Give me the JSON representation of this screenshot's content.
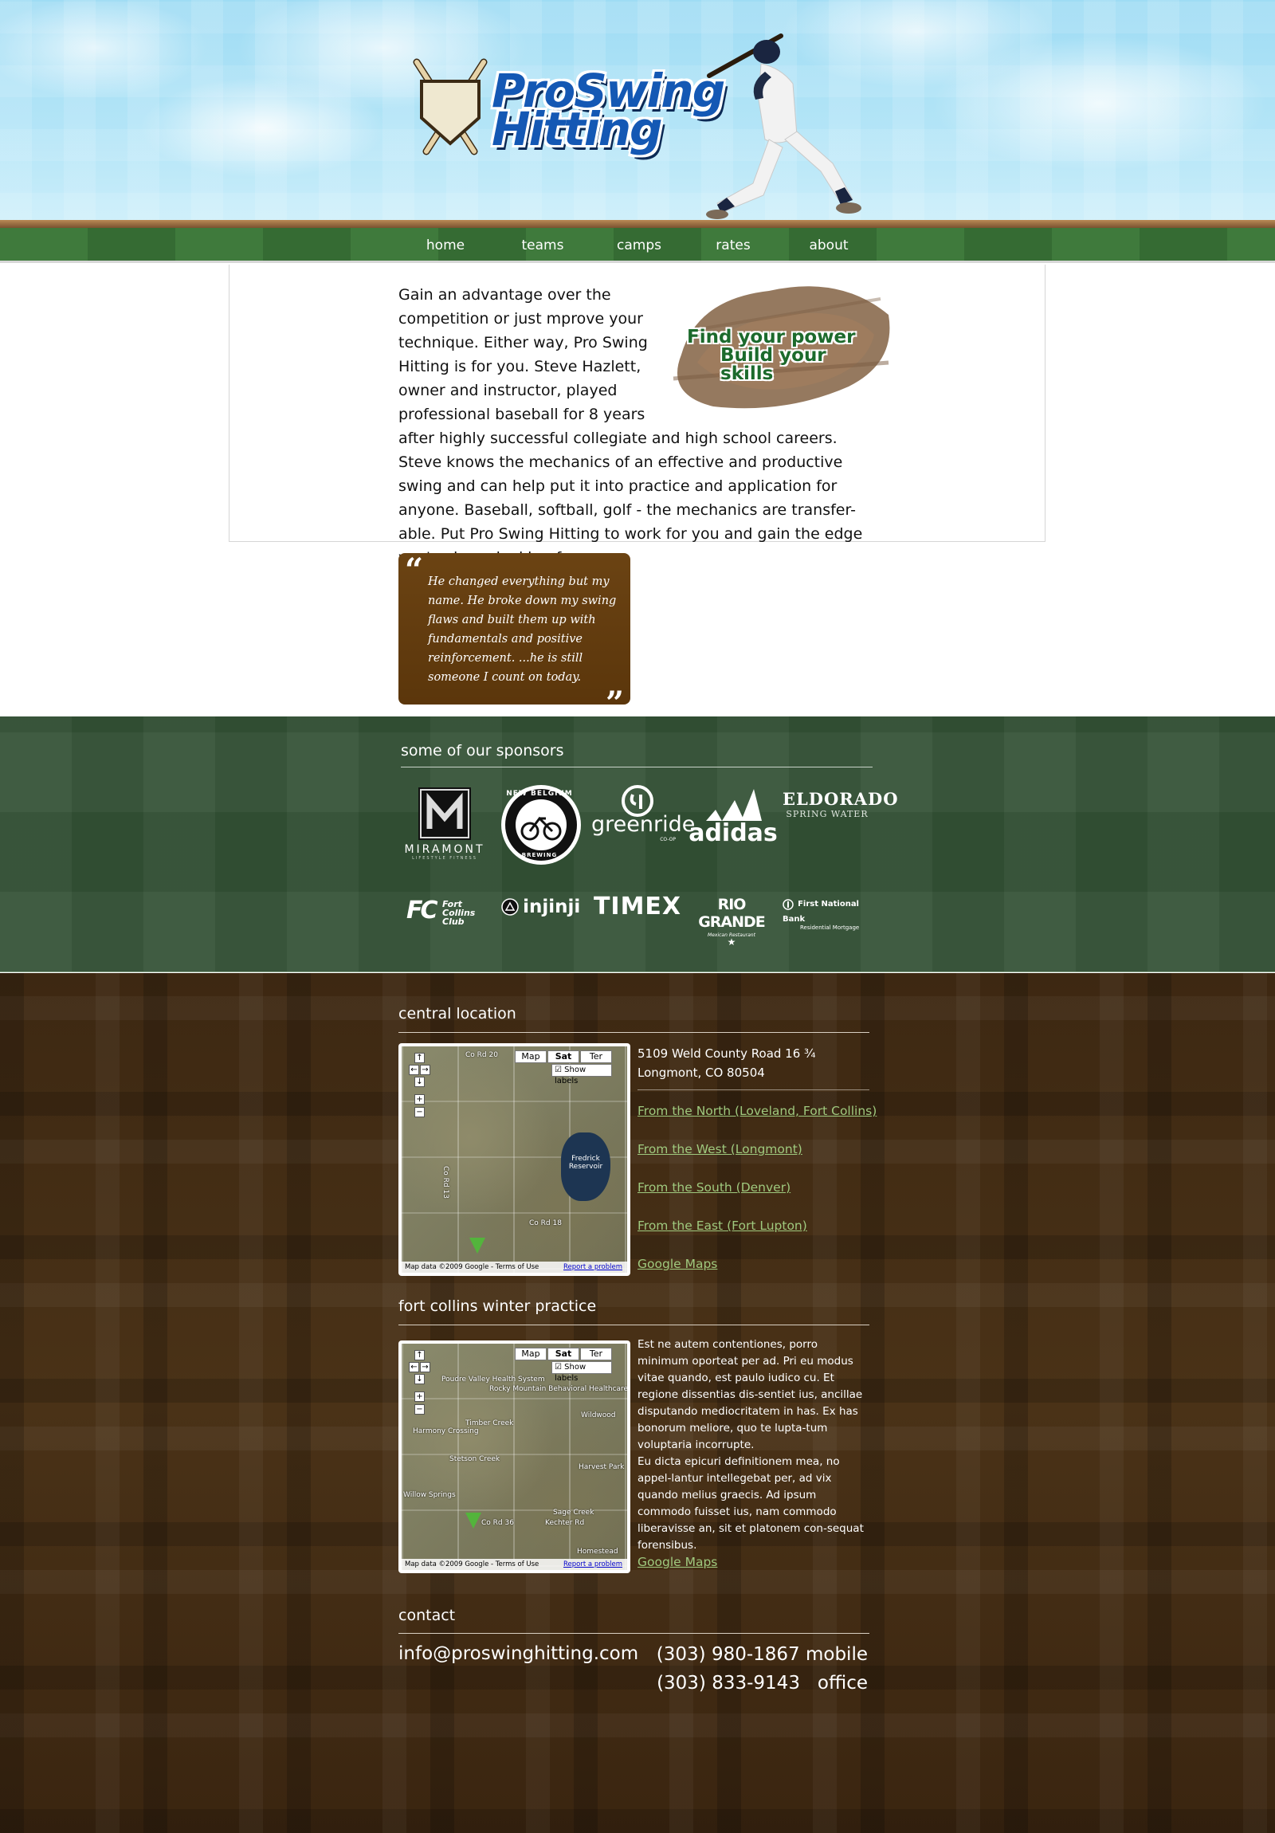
{
  "header": {
    "logo_line1": "ProSwing",
    "logo_line2": "Hitting"
  },
  "nav": {
    "items": [
      "home",
      "teams",
      "camps",
      "rates",
      "about"
    ]
  },
  "intro": {
    "paragraph": "Gain an advantage over the competition or just mprove your technique. Either way, Pro Swing Hitting is for you. Steve Hazlett, owner and instructor, played professional baseball for 8 years after highly successful collegiate and high school careers. Steve knows the mechanics of an effective and productive swing and can help put it into practice and application for anyone. Baseball, softball, golf - the mechanics are transfer-able. Put Pro Swing Hitting to work for you and gain the edge you've been looking for.",
    "tagline_1": "Find your power",
    "tagline_2": "Build your skills"
  },
  "testimonial": {
    "open_mark": "“",
    "text": "He changed everything but my name.  He broke down my swing flaws and built them up with fundamentals and positive reinforcement.  ...he is still someone I count on today.",
    "close_mark": "”"
  },
  "sponsors": {
    "title": "some of our sponsors",
    "logos": [
      {
        "name": "MIRAMONT",
        "sub": "LIFESTYLE FITNESS"
      },
      {
        "name": "NEW BELGIUM",
        "sub": "BREWING"
      },
      {
        "name": "greenride",
        "sub": "CO-OP"
      },
      {
        "name": "adidas",
        "sub": ""
      },
      {
        "name": "ELDORADO",
        "sub": "SPRING WATER"
      },
      {
        "name": "Fort Collins Club",
        "sub": ""
      },
      {
        "name": "injinji",
        "sub": ""
      },
      {
        "name": "TIMEX",
        "sub": ""
      },
      {
        "name": "RIO GRANDE",
        "sub": "Mexican Restaurant"
      },
      {
        "name": "First National Bank",
        "sub": "Residential Mortgage"
      }
    ]
  },
  "central_location": {
    "title": "central location",
    "address_line1": "5109 Weld County Road 16 ¾",
    "address_line2": "Longmont, CO 80504",
    "links": [
      "From the North (Loveland, Fort Collins)",
      "From the West (Longmont)",
      "From the South (Denver)",
      "From the East (Fort Lupton)",
      "Google Maps"
    ],
    "map": {
      "btn_map": "Map",
      "btn_sat": "Sat",
      "btn_ter": "Ter",
      "show_labels": "Show labels",
      "road_top": "Co Rd 20",
      "road_bottom": "Co Rd 18",
      "road_side": "Co Rd 13",
      "lake": "Fredrick Reservoir",
      "footer": "Map data ©2009 Google - Terms of Use",
      "report": "Report a problem"
    }
  },
  "winter": {
    "title": "fort collins winter practice",
    "paragraph1": "Est ne autem contentiones, porro minimum oporteat per ad. Pri eu modus vitae quando, est paulo iudico cu. Et regione dissentias dis-sentiet ius, ancillae disputando mediocritatem in has. Ex has bonorum meliore, quo te lupta-tum voluptaria incorrupte.",
    "paragraph2": "Eu dicta epicuri definitionem mea, no appel-lantur intellegebat per, ad vix quando melius graecis. Ad ipsum commodo fuisset ius, nam commodo liberavisse an, sit et platonem con-sequat forensibus.",
    "link": "Google Maps",
    "map": {
      "btn_map": "Map",
      "btn_sat": "Sat",
      "btn_ter": "Ter",
      "show_labels": "Show labels",
      "labels": [
        "Poudre Valley Health System",
        "Rocky Mountain Behavioral Healthcare",
        "Timber Creek",
        "Harmony Crossing",
        "Stetson Creek",
        "Wildwood",
        "Harvest Park",
        "Sage Creek",
        "Kechter Rd",
        "Homestead",
        "Co Rd 36",
        "Willow Springs"
      ],
      "footer": "Map data ©2009 Google - Terms of Use",
      "report": "Report a problem"
    }
  },
  "contact": {
    "title": "contact",
    "email": "info@proswinghitting.com",
    "phone_mobile": "(303) 980-1867 mobile",
    "phone_office": "(303) 833-9143   office"
  }
}
